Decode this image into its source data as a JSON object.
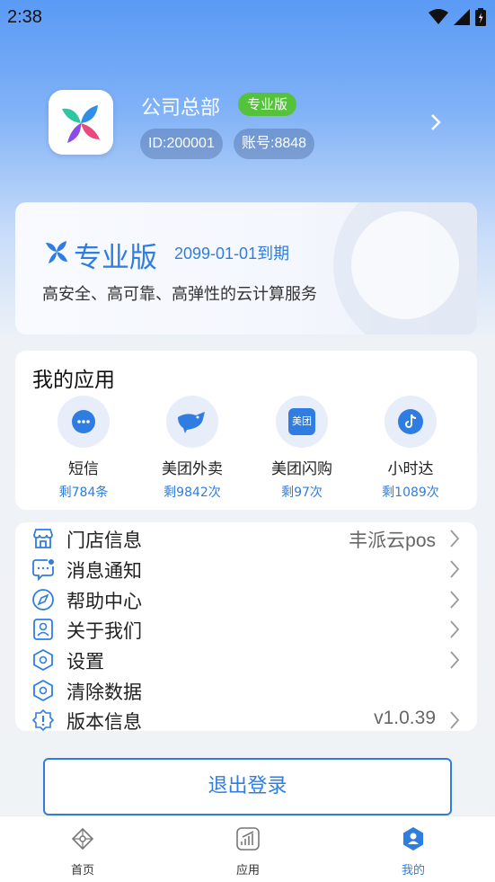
{
  "status": {
    "time": "2:38"
  },
  "profile": {
    "company": "公司总部",
    "edition_badge": "专业版",
    "id": "ID:200001",
    "account": "账号:8848"
  },
  "edition": {
    "title": "专业版",
    "expire": "2099-01-01到期",
    "description": "高安全、高可靠、高弹性的云计算服务"
  },
  "apps": {
    "title": "我的应用",
    "items": [
      {
        "name": "短信",
        "count": "剩784条",
        "icon": "sms-icon"
      },
      {
        "name": "美团外卖",
        "count": "剩9842次",
        "icon": "meituan-waimai-icon"
      },
      {
        "name": "美团闪购",
        "count": "剩97次",
        "icon": "meituan-shangou-icon",
        "icon_text": "美团"
      },
      {
        "name": "小时达",
        "count": "剩1089次",
        "icon": "tiktok-icon"
      }
    ]
  },
  "menu": [
    {
      "label": "门店信息",
      "value": "丰派云pos",
      "icon": "store-icon"
    },
    {
      "label": "消息通知",
      "value": "",
      "icon": "message-icon"
    },
    {
      "label": "帮助中心",
      "value": "",
      "icon": "help-icon"
    },
    {
      "label": "关于我们",
      "value": "",
      "icon": "about-icon"
    },
    {
      "label": "设置",
      "value": "",
      "icon": "settings-icon"
    },
    {
      "label": "清除数据",
      "value": "",
      "icon": "clear-data-icon"
    },
    {
      "label": "版本信息",
      "value": "v1.0.39",
      "icon": "version-icon"
    }
  ],
  "logout_label": "退出登录",
  "tabs": [
    {
      "label": "首页",
      "icon": "home-icon"
    },
    {
      "label": "应用",
      "icon": "apps-icon"
    },
    {
      "label": "我的",
      "icon": "profile-icon"
    }
  ],
  "colors": {
    "accent": "#2f7de1",
    "badge_green": "#55c23b"
  }
}
